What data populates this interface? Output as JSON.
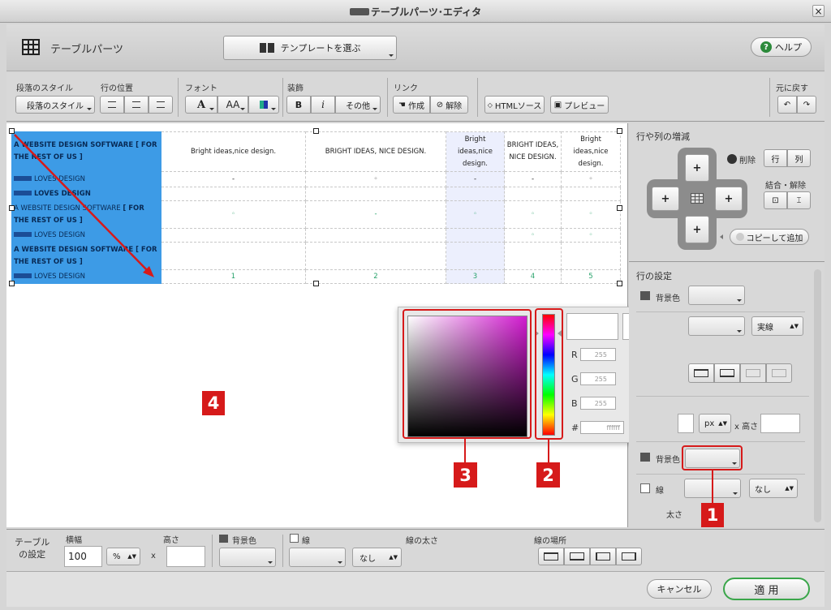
{
  "window": {
    "title_suffix": "テーブルパーツ･エディタ",
    "close_glyph": "×"
  },
  "header": {
    "title": "テーブルパーツ",
    "template_button": "テンプレートを選ぶ",
    "help_button": "ヘルプ"
  },
  "toolbar": {
    "paragraph_style_label": "段落のスタイル",
    "paragraph_style_button": "段落のスタイル",
    "row_position_label": "行の位置",
    "font_label": "フォント",
    "font_a": "A",
    "font_size_a": "AA",
    "decoration_label": "装飾",
    "bold": "B",
    "italic": "i",
    "other": "その他",
    "link_label": "リンク",
    "link_create": "作成",
    "link_remove": "解除",
    "html_source": "HTMLソース",
    "preview": "プレビュー",
    "undo_label": "元に戻す"
  },
  "table": {
    "r1": {
      "c0": "A WEBSITE DESIGN SOFTWARE [ FOR THE REST OF US ]",
      "c1": "Bright ideas,nice design.",
      "c2": "BRIGHT IDEAS, NICE DESIGN.",
      "c3": "Bright ideas,nice design.",
      "c4": "BRIGHT IDEAS, NICE DESIGN.",
      "c5": "Bright ideas,nice design."
    },
    "r2": {
      "c0": "LOVES DESIGN",
      "c1": "-",
      "c2": "◦",
      "c3": "-",
      "c4": "-",
      "c5": "◦"
    },
    "r3": {
      "c0": "LOVES DESIGN"
    },
    "r4": {
      "c0a": "A WEBSITE DESIGN SOFTWARE ",
      "c0b": "[ FOR THE REST OF US ]",
      "c1": "◦",
      "c2": "-",
      "c3": "◦",
      "c4": "◦",
      "c5": "◦"
    },
    "r5": {
      "c0": "LOVES DESIGN",
      "c4": "◦",
      "c5": "◦"
    },
    "r6": {
      "c0": "A WEBSITE DESIGN SOFTWARE [ FOR THE REST OF US ]"
    },
    "r7": {
      "c0": "LOVES DESIGN",
      "c1": "1",
      "c2": "2",
      "c3": "3",
      "c4": "4",
      "c5": "5"
    }
  },
  "color_picker": {
    "r_label": "R",
    "g_label": "G",
    "b_label": "B",
    "r": "255",
    "g": "255",
    "b": "255",
    "hash": "#",
    "hex": "ffffff"
  },
  "markers": {
    "m1": "1",
    "m2": "2",
    "m3": "3",
    "m4": "4"
  },
  "right_panel": {
    "rowcol_title": "行や列の増減",
    "delete_label": "削除",
    "row_button": "行",
    "col_button": "列",
    "merge_label": "結合・解除",
    "copy_add": "コピーして追加",
    "plus": "+",
    "row_settings": "行の設定",
    "bg_color": "背景色",
    "solid": "実線",
    "px": "px",
    "x_height": "x 高さ",
    "bg_color2": "背景色",
    "line": "線",
    "none": "なし",
    "thickness": "太さ"
  },
  "bottom": {
    "table_settings_1": "テーブル",
    "table_settings_2": "の設定",
    "width_label": "横幅",
    "width_value": "100",
    "unit": "%",
    "times": "x",
    "height_label": "高さ",
    "bg_color": "背景色",
    "line": "線",
    "line_width": "線の太さ",
    "none": "なし",
    "line_place": "線の場所"
  },
  "footer": {
    "cancel": "キャンセル",
    "apply": "適 用"
  },
  "colors": {
    "accent": "#3d9be6",
    "marker": "#d61a1a",
    "apply_border": "#3aa64a"
  }
}
